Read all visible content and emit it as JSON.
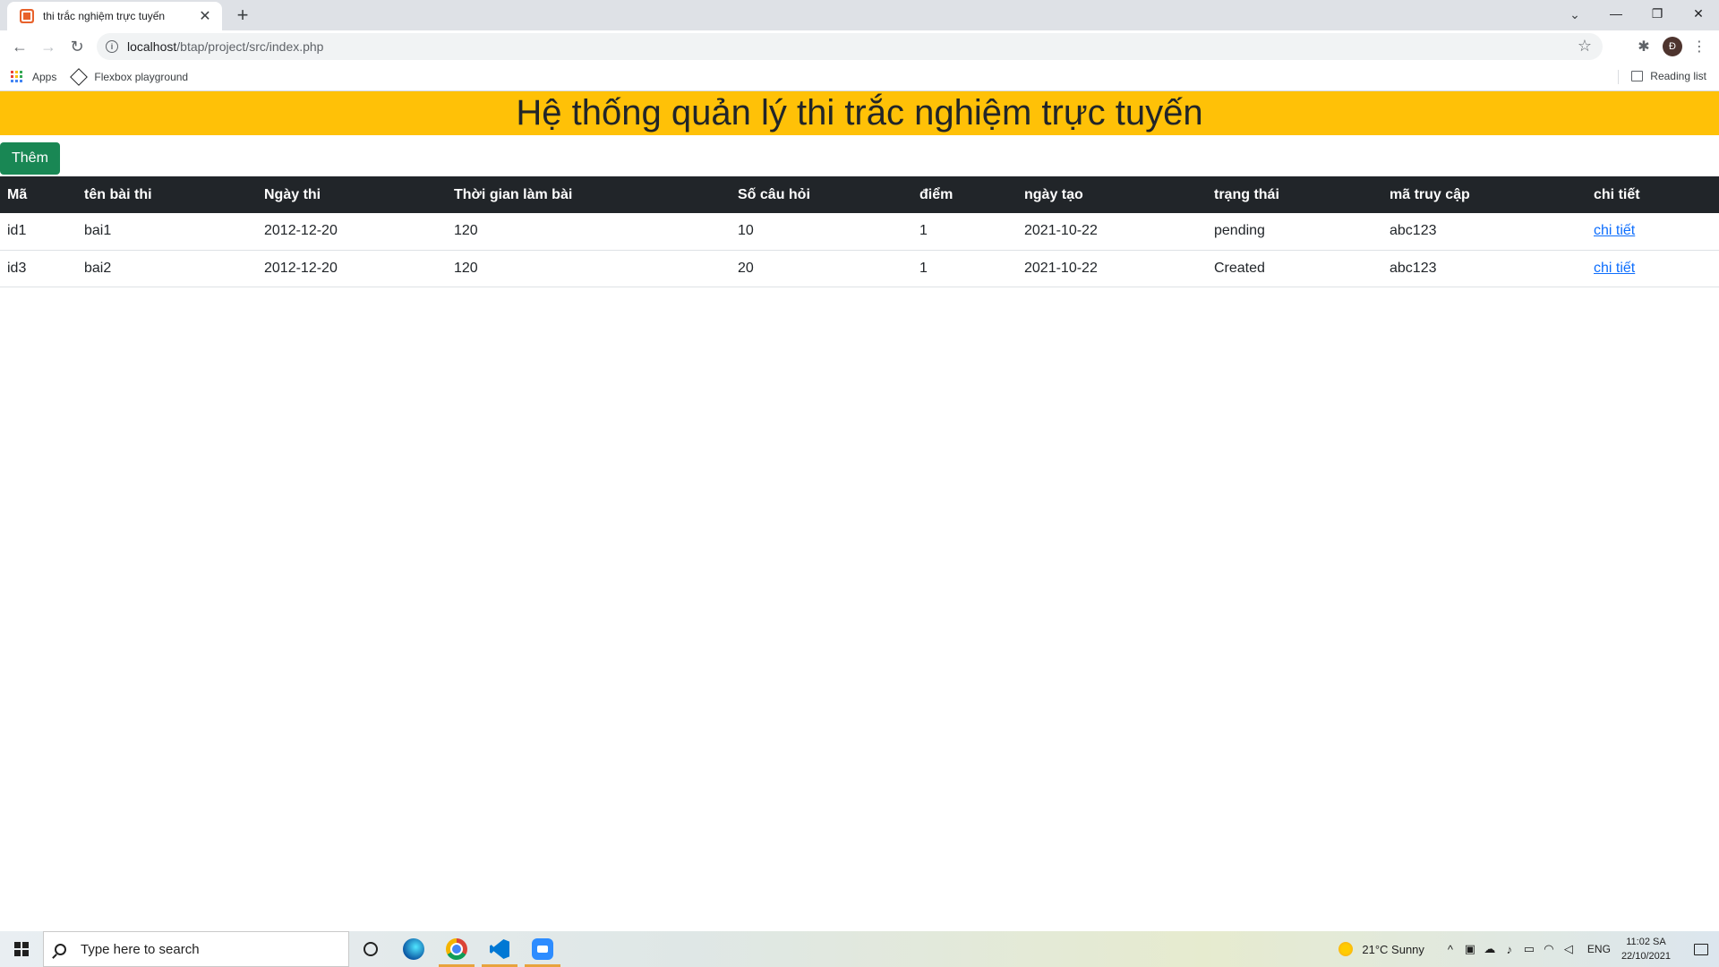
{
  "browser": {
    "tab_title": "thi trắc nghiệm trực tuyến",
    "url_host": "localhost",
    "url_path": "/btap/project/src/index.php",
    "profile_initial": "Đ",
    "bookmarks": [
      {
        "label": "Apps",
        "icon": "apps-grid-icon"
      },
      {
        "label": "Flexbox playground",
        "icon": "codepen-icon"
      }
    ],
    "reading_list": "Reading list"
  },
  "page": {
    "title": "Hệ thống quản lý thi trắc nghiệm trực tuyến",
    "add_button": "Thêm",
    "accent_color": "#ffc107",
    "button_color": "#198754",
    "table": {
      "headers": [
        "Mã",
        "tên bài thi",
        "Ngày thi",
        "Thời gian làm bài",
        "Số câu hỏi",
        "điểm",
        "ngày tạo",
        "trạng thái",
        "mã truy cập",
        "chi tiết"
      ],
      "rows": [
        [
          "id1",
          "bai1",
          "2012-12-20",
          "120",
          "10",
          "1",
          "2021-10-22",
          "pending",
          "abc123",
          "chi tiết"
        ],
        [
          "id3",
          "bai2",
          "2012-12-20",
          "120",
          "20",
          "1",
          "2021-10-22",
          "Created",
          "abc123",
          "chi tiết"
        ]
      ]
    }
  },
  "taskbar": {
    "search_placeholder": "Type here to search",
    "weather": "21°C  Sunny",
    "language": "ENG",
    "time": "11:02 SA",
    "date": "22/10/2021"
  }
}
